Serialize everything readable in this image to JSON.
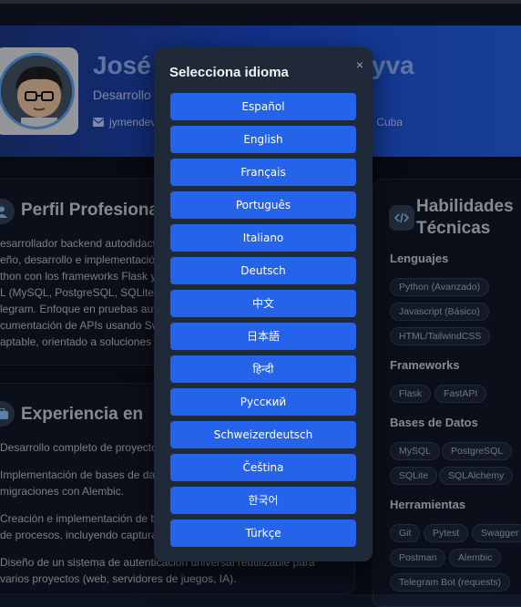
{
  "header": {
    "name_left": "José",
    "name_right": "yva",
    "role": "Desarrollo",
    "email": "jymendev",
    "location": "n, Cuba"
  },
  "profile": {
    "title": "Perfil Profesiona",
    "lines": [
      "esarrollador backend autodidacta",
      "eño, desarrollo e implementació",
      "thon con los frameworks Flask y",
      "L (MySQL, PostgreSQL, SQLite) y",
      "legram. Enfoque en pruebas auto",
      "cumentación de APIs usando Sw",
      "aptable, orientado a soluciones p"
    ]
  },
  "experience": {
    "title": "Experiencia en",
    "items": [
      [
        "Desarrollo completo de proyecto"
      ],
      [
        "Implementación de bases de da",
        "migraciones con Alembic."
      ],
      [
        "Creación e implementación de b",
        "de procesos, incluyendo captura"
      ],
      [
        "Diseño de un sistema de autenticación universal reutilizable para",
        "varios proyectos (web, servidores de juegos, IA)."
      ]
    ]
  },
  "skills": {
    "title_line1": "Habilidades",
    "title_line2": "Técnicas",
    "groups": [
      {
        "title": "Lenguajes",
        "items": [
          "Python (Avanzado)",
          "Javascript (Básico)",
          "HTML/TailwindCSS"
        ]
      },
      {
        "title": "Frameworks",
        "items": [
          "Flask",
          "FastAPI"
        ]
      },
      {
        "title": "Bases de Datos",
        "items": [
          "MySQL",
          "PostgreSQL",
          "SQLite",
          "SQLAlchemy"
        ]
      },
      {
        "title": "Herramientas",
        "items": [
          "Git",
          "Pytest",
          "Swagger",
          "Postman",
          "Alembic",
          "Telegram Bot (requests)"
        ]
      }
    ]
  },
  "modal": {
    "title": "Selecciona idioma",
    "close": "×",
    "languages": [
      "Español",
      "English",
      "Français",
      "Português",
      "Italiano",
      "Deutsch",
      "中文",
      "日本語",
      "हिन्दी",
      "Русский",
      "Schweizerdeutsch",
      "Čeština",
      "한국어",
      "Türkçe"
    ]
  },
  "icons": {
    "email": "envelope-icon",
    "profile": "user-icon",
    "experience": "briefcase-icon",
    "skills": "code-icon"
  },
  "colors": {
    "accent": "#2563eb",
    "background": "#0b1220",
    "card": "#111827",
    "modal": "#1f2937"
  }
}
